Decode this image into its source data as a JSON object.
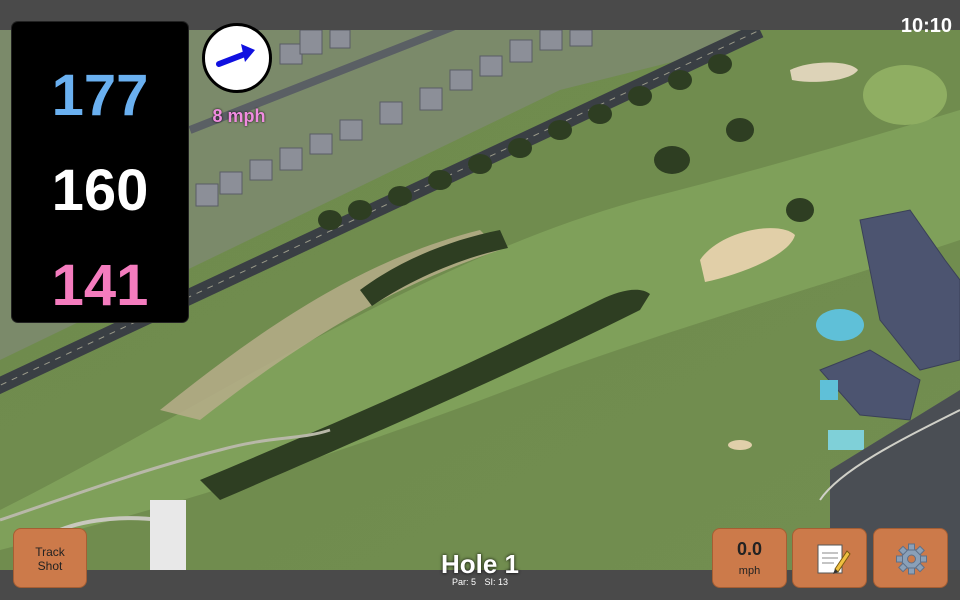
{
  "status": {
    "time": "10:10"
  },
  "distances": {
    "back": "177",
    "middle": "160",
    "front": "141"
  },
  "wind": {
    "speed_label": "8 mph",
    "direction": "east-northeast"
  },
  "hole": {
    "title": "Hole 1",
    "par_label": "Par: 5",
    "si_label": "SI: 13"
  },
  "buttons": {
    "track_shot": "Track Shot",
    "wind_value": "0.0",
    "wind_unit": "mph",
    "notes_icon": "notepad-icon",
    "settings_icon": "gear-icon"
  },
  "colors": {
    "back": "#6ab0f0",
    "middle": "#ffffff",
    "front": "#f47cbe",
    "button": "#cc7a4a",
    "wind_label": "#f08ce0"
  }
}
